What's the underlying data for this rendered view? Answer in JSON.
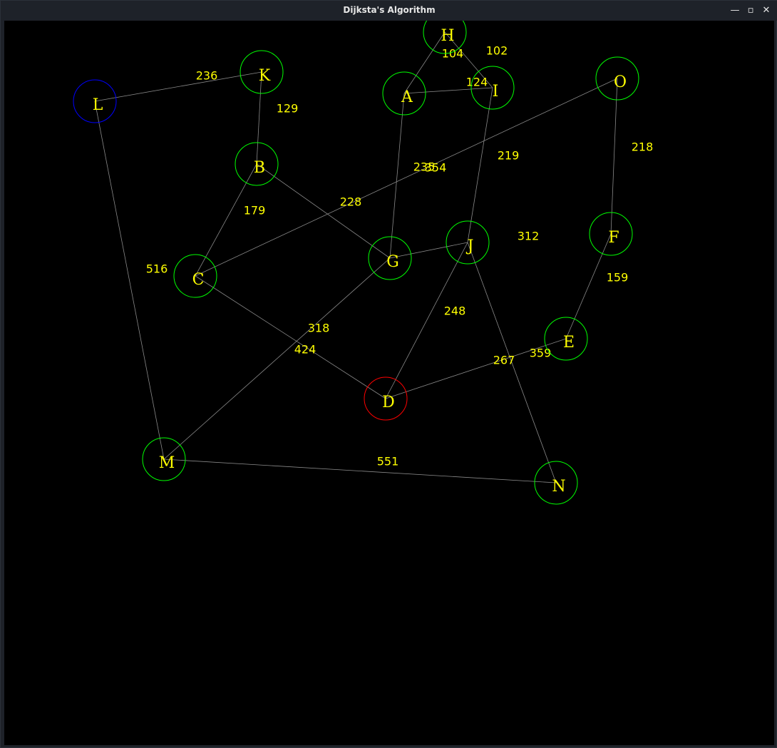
{
  "window": {
    "title": "Dijksta's Algorithm"
  },
  "controls": {
    "minimize": "—",
    "maximize": "▫",
    "close": "✕"
  },
  "colors": {
    "background": "#000000",
    "edge": "#8a8a8a",
    "node_default": "#00ff00",
    "node_start": "#0000ff",
    "node_current": "#ff0000",
    "label": "#ffff00"
  },
  "nodes": [
    {
      "id": "A",
      "state": "default"
    },
    {
      "id": "B",
      "state": "default"
    },
    {
      "id": "C",
      "state": "default"
    },
    {
      "id": "D",
      "state": "current"
    },
    {
      "id": "E",
      "state": "default"
    },
    {
      "id": "F",
      "state": "default"
    },
    {
      "id": "G",
      "state": "default"
    },
    {
      "id": "H",
      "state": "default"
    },
    {
      "id": "I",
      "state": "default"
    },
    {
      "id": "J",
      "state": "default"
    },
    {
      "id": "K",
      "state": "default"
    },
    {
      "id": "L",
      "state": "start"
    },
    {
      "id": "M",
      "state": "default"
    },
    {
      "id": "N",
      "state": "default"
    },
    {
      "id": "O",
      "state": "default"
    }
  ],
  "edges": [
    {
      "from": "L",
      "to": "K",
      "weight": "236"
    },
    {
      "from": "K",
      "to": "B",
      "weight": "129"
    },
    {
      "from": "B",
      "to": "C",
      "weight": "179"
    },
    {
      "from": "B",
      "to": "G",
      "weight": "228"
    },
    {
      "from": "L",
      "to": "M",
      "weight": "516"
    },
    {
      "from": "C",
      "to": "D",
      "weight": "318"
    },
    {
      "from": "G",
      "to": "M",
      "weight": "424"
    },
    {
      "from": "M",
      "to": "N",
      "weight": "551"
    },
    {
      "from": "H",
      "to": "A",
      "weight": "104"
    },
    {
      "from": "H",
      "to": "I",
      "weight": "102"
    },
    {
      "from": "A",
      "to": "I",
      "weight": "124"
    },
    {
      "from": "A",
      "to": "G",
      "weight": "235"
    },
    {
      "from": "O",
      "to": "C",
      "weight": "354"
    },
    {
      "from": "I",
      "to": "J",
      "weight": "219"
    },
    {
      "from": "O",
      "to": "F",
      "weight": "218"
    },
    {
      "from": "G",
      "to": "J",
      "weight": "312"
    },
    {
      "from": "F",
      "to": "E",
      "weight": "159"
    },
    {
      "from": "J",
      "to": "D",
      "weight": "248"
    },
    {
      "from": "D",
      "to": "E",
      "weight": "267"
    },
    {
      "from": "J",
      "to": "N",
      "weight": "359"
    }
  ]
}
